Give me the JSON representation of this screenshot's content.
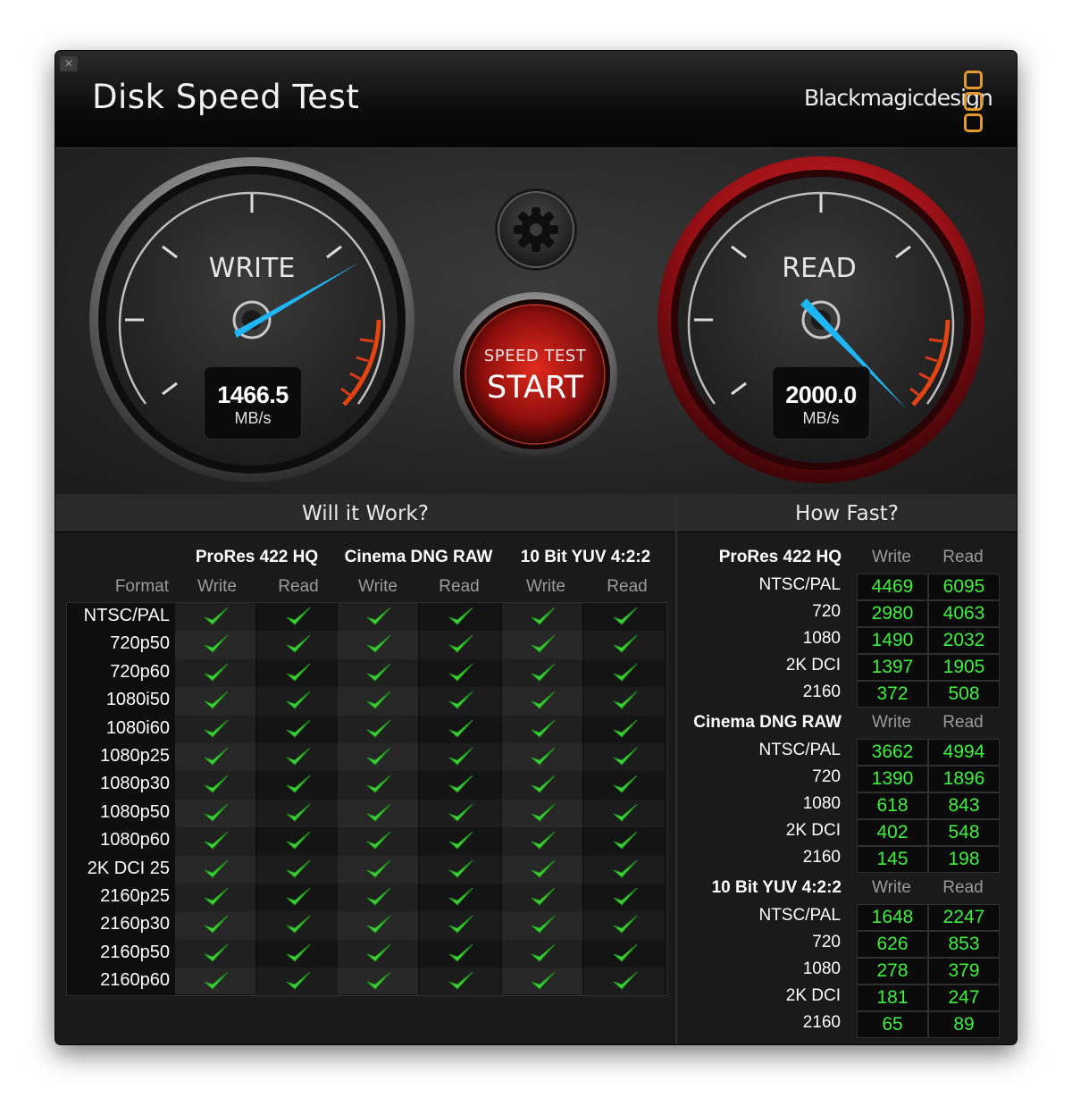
{
  "window": {
    "title": "Disk Speed Test",
    "close_glyph": "×",
    "brand": "Blackmagicdesign"
  },
  "gauges": {
    "write": {
      "label": "WRITE",
      "value": "1466.5",
      "unit": "MB/s"
    },
    "read": {
      "label": "READ",
      "value": "2000.0",
      "unit": "MB/s"
    }
  },
  "controls": {
    "start_top": "SPEED TEST",
    "start_main": "START",
    "settings_icon": "gear-icon"
  },
  "will_it_work": {
    "heading": "Will it Work?",
    "format_header": "Format",
    "groups": [
      "ProRes 422 HQ",
      "Cinema DNG RAW",
      "10 Bit YUV 4:2:2"
    ],
    "sub_headers": [
      "Write",
      "Read",
      "Write",
      "Read",
      "Write",
      "Read"
    ],
    "rows": [
      "NTSC/PAL",
      "720p50",
      "720p60",
      "1080i50",
      "1080i60",
      "1080p25",
      "1080p30",
      "1080p50",
      "1080p60",
      "2K DCI 25",
      "2160p25",
      "2160p30",
      "2160p50",
      "2160p60"
    ],
    "status_icon": "checkmark-icon"
  },
  "how_fast": {
    "heading": "How Fast?",
    "sub_headers": {
      "write": "Write",
      "read": "Read"
    },
    "groups": [
      {
        "name": "ProRes 422 HQ",
        "rows": [
          {
            "label": "NTSC/PAL",
            "write": "4469",
            "read": "6095"
          },
          {
            "label": "720",
            "write": "2980",
            "read": "4063"
          },
          {
            "label": "1080",
            "write": "1490",
            "read": "2032"
          },
          {
            "label": "2K DCI",
            "write": "1397",
            "read": "1905"
          },
          {
            "label": "2160",
            "write": "372",
            "read": "508"
          }
        ]
      },
      {
        "name": "Cinema DNG RAW",
        "rows": [
          {
            "label": "NTSC/PAL",
            "write": "3662",
            "read": "4994"
          },
          {
            "label": "720",
            "write": "1390",
            "read": "1896"
          },
          {
            "label": "1080",
            "write": "618",
            "read": "843"
          },
          {
            "label": "2K DCI",
            "write": "402",
            "read": "548"
          },
          {
            "label": "2160",
            "write": "145",
            "read": "198"
          }
        ]
      },
      {
        "name": "10 Bit YUV 4:2:2",
        "rows": [
          {
            "label": "NTSC/PAL",
            "write": "1648",
            "read": "2247"
          },
          {
            "label": "720",
            "write": "626",
            "read": "853"
          },
          {
            "label": "1080",
            "write": "278",
            "read": "379"
          },
          {
            "label": "2K DCI",
            "write": "181",
            "read": "247"
          },
          {
            "label": "2160",
            "write": "65",
            "read": "89"
          }
        ]
      }
    ]
  },
  "colors": {
    "accent_orange": "#e39a2a",
    "value_green": "#3ff03f",
    "needle_blue": "#1fb6f5",
    "read_ring_red": "#a3141a"
  }
}
